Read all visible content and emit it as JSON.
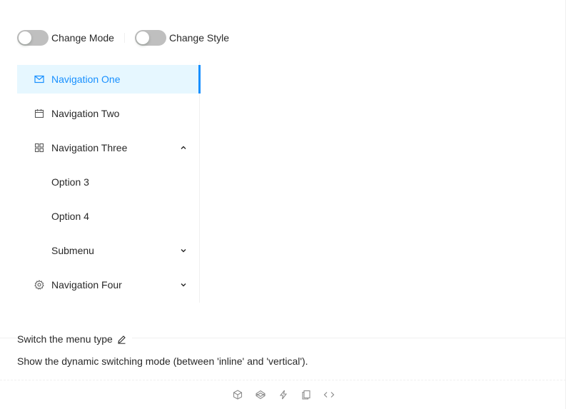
{
  "controls": {
    "mode_label": "Change Mode",
    "style_label": "Change Style"
  },
  "menu": {
    "items": [
      {
        "label": "Navigation One",
        "icon": "mail-icon",
        "selected": true
      },
      {
        "label": "Navigation Two",
        "icon": "calendar-icon"
      },
      {
        "label": "Navigation Three",
        "icon": "appstore-icon",
        "expanded": true
      },
      {
        "label": "Option 3"
      },
      {
        "label": "Option 4"
      },
      {
        "label": "Submenu",
        "expanded": false
      },
      {
        "label": "Navigation Four",
        "icon": "setting-icon",
        "expanded": false
      }
    ]
  },
  "description": {
    "title": "Switch the menu type",
    "text": "Show the dynamic switching mode (between 'inline' and 'vertical')."
  },
  "actions": {
    "icons": [
      "codesandbox-icon",
      "codepen-icon",
      "thunderbolt-icon",
      "copy-icon",
      "code-icon"
    ]
  },
  "colors": {
    "primary": "#1890ff",
    "selected_bg": "#e6f7ff",
    "switch_off": "#bfbfbf"
  }
}
